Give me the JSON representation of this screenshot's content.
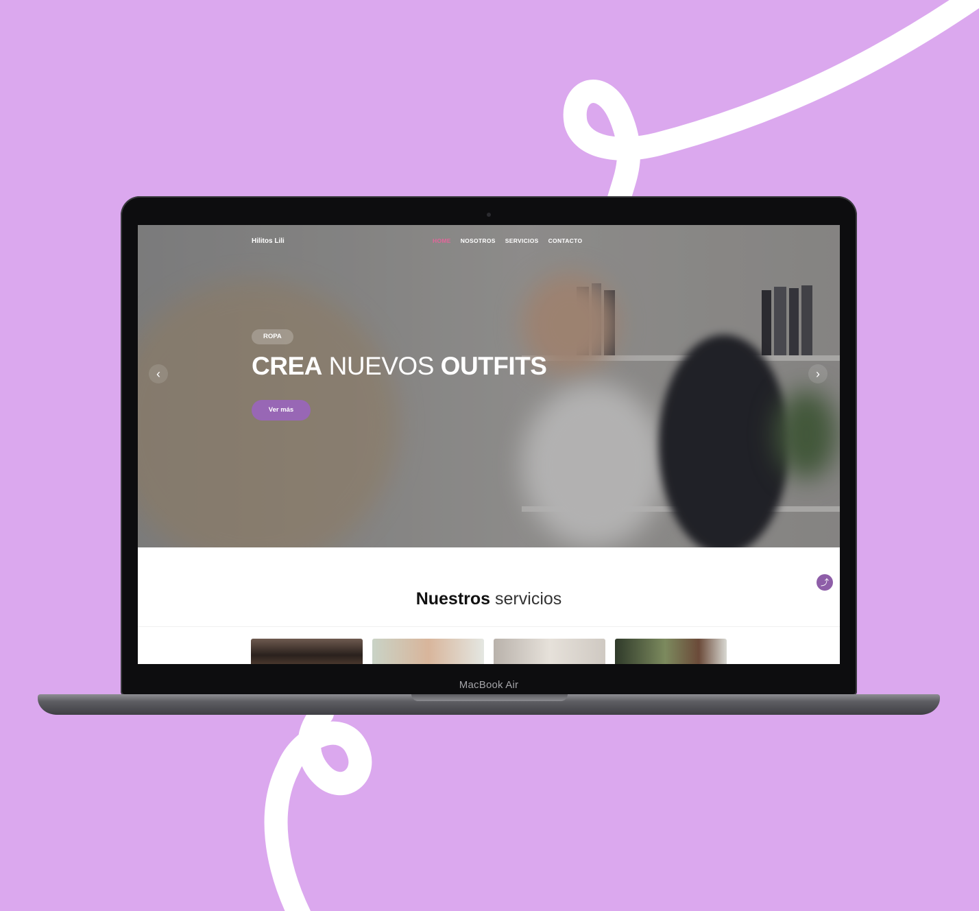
{
  "site": {
    "brand": "Hilitos Lili",
    "nav": [
      {
        "label": "HOME",
        "active": true
      },
      {
        "label": "NOSOTROS",
        "active": false
      },
      {
        "label": "SERVICIOS",
        "active": false
      },
      {
        "label": "CONTACTO",
        "active": false
      }
    ]
  },
  "hero": {
    "badge": "ROPA",
    "headline": {
      "part1": "CREA",
      "part2": "NUEVOS",
      "part3": "OUTFITS"
    },
    "cta_label": "Ver más",
    "prev_icon": "‹",
    "next_icon": "›"
  },
  "services": {
    "title_strong": "Nuestros",
    "title_light": "servicios",
    "scroll_top_icon": "⤴"
  },
  "device": {
    "label": "MacBook Air"
  },
  "colors": {
    "background": "#dba8ee",
    "accent": "#9867b5",
    "nav_active": "#e3659a"
  }
}
